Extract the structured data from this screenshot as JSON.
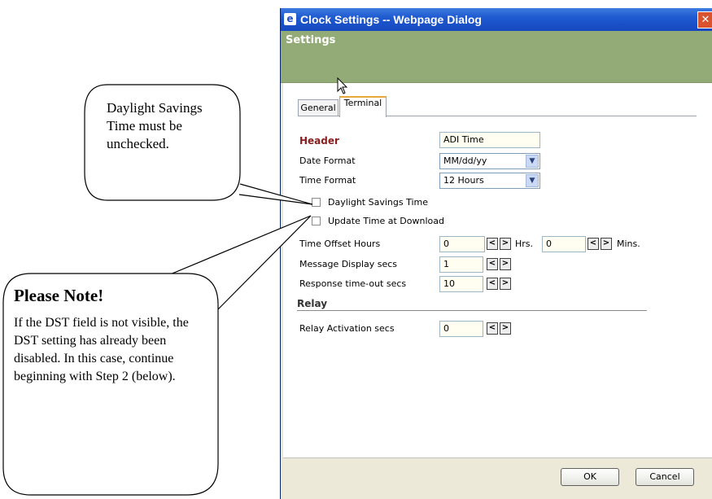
{
  "window": {
    "title": "Clock Settings -- Webpage Dialog",
    "close_glyph": "✕",
    "title_icon": "ie-page-icon"
  },
  "header": {
    "title": "Settings"
  },
  "tabs": [
    {
      "label": "General",
      "active": false
    },
    {
      "label": "Terminal",
      "active": true
    }
  ],
  "form": {
    "header_label": "Header",
    "header_value": "ADI Time",
    "date_format_label": "Date Format",
    "date_format_value": "MM/dd/yy",
    "time_format_label": "Time Format",
    "time_format_value": "12 Hours",
    "dst_label": "Daylight Savings Time",
    "dst_checked": false,
    "update_time_label": "Update Time at Download",
    "update_time_checked": false,
    "offset_label": "Time Offset Hours",
    "offset_hours_value": "0",
    "hrs_unit": "Hrs.",
    "offset_mins_value": "0",
    "mins_unit": "Mins.",
    "message_display_label": "Message Display secs",
    "message_display_value": "1",
    "response_timeout_label": "Response time-out secs",
    "response_timeout_value": "10",
    "relay_section": "Relay",
    "relay_activation_label": "Relay Activation secs",
    "relay_activation_value": "0",
    "spin_prev": "<",
    "spin_next": ">",
    "dropdown_arrow": "▼"
  },
  "buttons": {
    "ok": "OK",
    "cancel": "Cancel"
  },
  "callouts": {
    "dst": "Daylight Savings Time must be unchecked.",
    "note_title": "Please Note!",
    "note_body": "If the DST field is not visible, the DST setting has already been disabled. In this case, continue beginning with Step 2 (below)."
  },
  "colors": {
    "title_bar": "#1f5ad0",
    "header_band": "#93ab76",
    "header_label": "#8b1d1d",
    "active_tab_accent": "#e6a93a"
  }
}
